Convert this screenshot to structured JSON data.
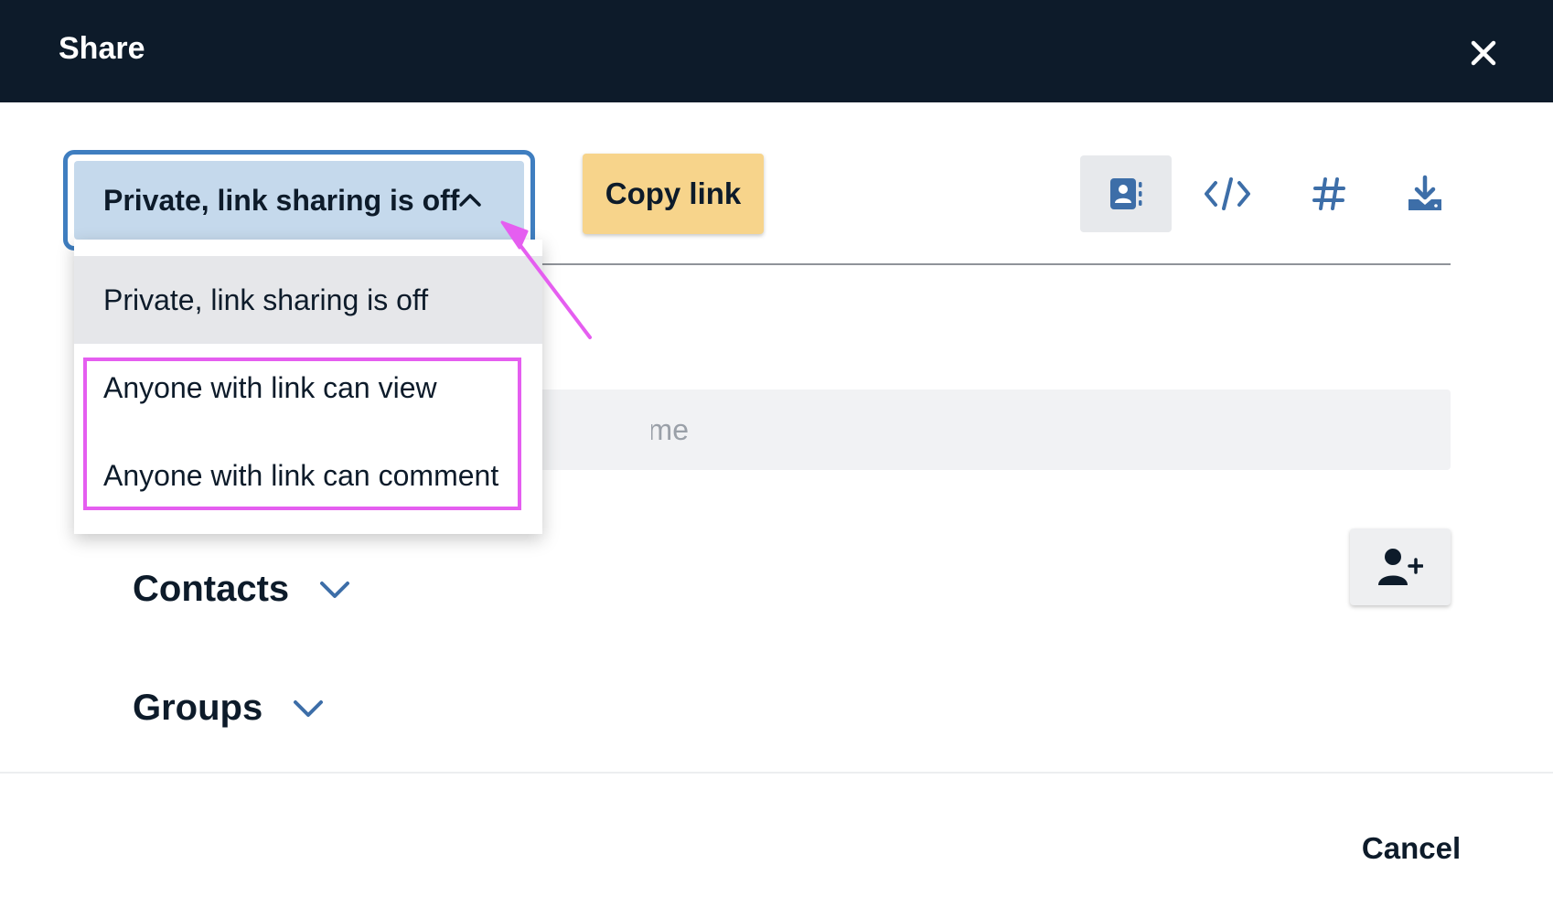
{
  "dialog": {
    "title": "Share"
  },
  "privacy": {
    "selected_label": "Private, link sharing is off",
    "options": [
      {
        "label": "Private, link sharing is off",
        "selected": true
      },
      {
        "label": "Anyone with link can view",
        "selected": false
      },
      {
        "label": "Anyone with link can comment",
        "selected": false
      }
    ]
  },
  "toolbar": {
    "copy_link_label": "Copy link",
    "tabs": [
      {
        "icon": "contact-book-icon",
        "active": true
      },
      {
        "icon": "code-icon",
        "active": false
      },
      {
        "icon": "hash-icon",
        "active": false
      },
      {
        "icon": "download-icon",
        "active": false
      }
    ]
  },
  "search": {
    "placeholder": "ourse name"
  },
  "sections": {
    "contacts_label": "Contacts",
    "groups_label": "Groups"
  },
  "footer": {
    "cancel_label": "Cancel"
  },
  "colors": {
    "header_bg": "#0d1b2a",
    "select_bg": "#c5d9ec",
    "select_focus": "#3f7ec0",
    "copy_link_bg": "#f7d48b",
    "icon_blue": "#3d6ea8",
    "annotation": "#e55ef0"
  }
}
